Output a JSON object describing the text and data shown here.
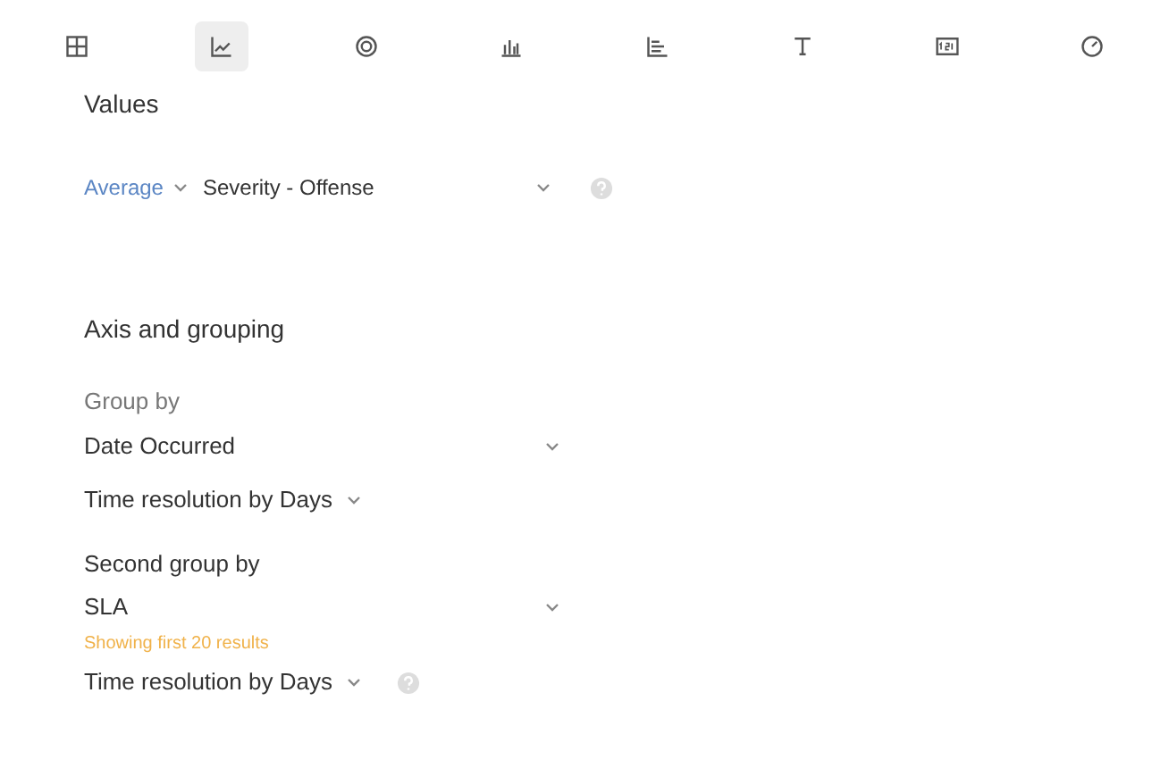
{
  "toolbar": [
    {
      "kind": "table",
      "selected": false
    },
    {
      "kind": "line",
      "selected": true
    },
    {
      "kind": "donut",
      "selected": false
    },
    {
      "kind": "bar",
      "selected": false
    },
    {
      "kind": "hbar",
      "selected": false
    },
    {
      "kind": "text",
      "selected": false
    },
    {
      "kind": "number",
      "selected": false
    },
    {
      "kind": "gauge",
      "selected": false
    }
  ],
  "values": {
    "title": "Values",
    "aggregation": "Average",
    "field": "Severity - Offense"
  },
  "axis": {
    "title": "Axis and grouping",
    "group_by": {
      "label": "Group by",
      "value": "Date Occurred",
      "resolution": "Time resolution by Days"
    },
    "second_group_by": {
      "label": "Second group by",
      "value": "SLA",
      "warning": "Showing first 20 results",
      "resolution": "Time resolution by Days"
    }
  }
}
